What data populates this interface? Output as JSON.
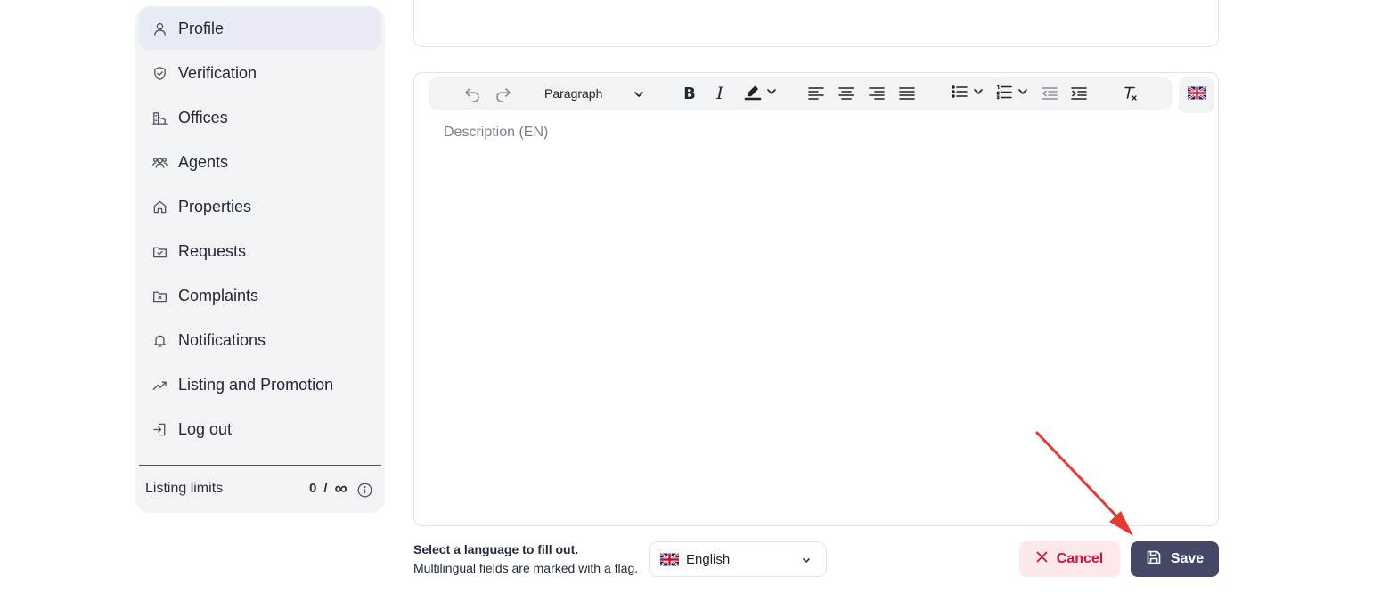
{
  "sidebar": {
    "items": [
      {
        "label": "Profile",
        "icon": "user-icon",
        "active": true
      },
      {
        "label": "Verification",
        "icon": "shield-check-icon"
      },
      {
        "label": "Offices",
        "icon": "building-icon"
      },
      {
        "label": "Agents",
        "icon": "users-icon"
      },
      {
        "label": "Properties",
        "icon": "home-icon"
      },
      {
        "label": "Requests",
        "icon": "folder-check-icon"
      },
      {
        "label": "Complaints",
        "icon": "folder-x-icon"
      },
      {
        "label": "Notifications",
        "icon": "bell-icon"
      },
      {
        "label": "Listing and Promotion",
        "icon": "trending-up-icon"
      },
      {
        "label": "Log out",
        "icon": "log-in-icon"
      }
    ],
    "limits": {
      "label": "Listing limits",
      "used": "0",
      "separator": "/",
      "max": "∞"
    }
  },
  "editor": {
    "block_format": "Paragraph",
    "placeholder": "Description (EN)",
    "toolbar_icons": [
      "undo-icon",
      "redo-icon",
      "bold-icon",
      "italic-icon",
      "highlight-icon",
      "align-left-icon",
      "align-center-icon",
      "align-right-icon",
      "align-justify-icon",
      "bullet-list-icon",
      "numbered-list-icon",
      "outdent-icon",
      "indent-icon",
      "clear-format-icon",
      "uk-flag-icon"
    ],
    "bold_glyph": "B",
    "italic_glyph": "I"
  },
  "footer": {
    "hint_title": "Select a language to fill out.",
    "hint_sub": "Multilingual fields are marked with a flag.",
    "language": "English",
    "cancel_label": "Cancel",
    "save_label": "Save"
  },
  "colors": {
    "accent": "#454866",
    "danger": "#c8163b",
    "danger_bg": "#fde8ec",
    "sidebar_bg": "#f1f3f5",
    "annotation_arrow": "#e53935"
  }
}
